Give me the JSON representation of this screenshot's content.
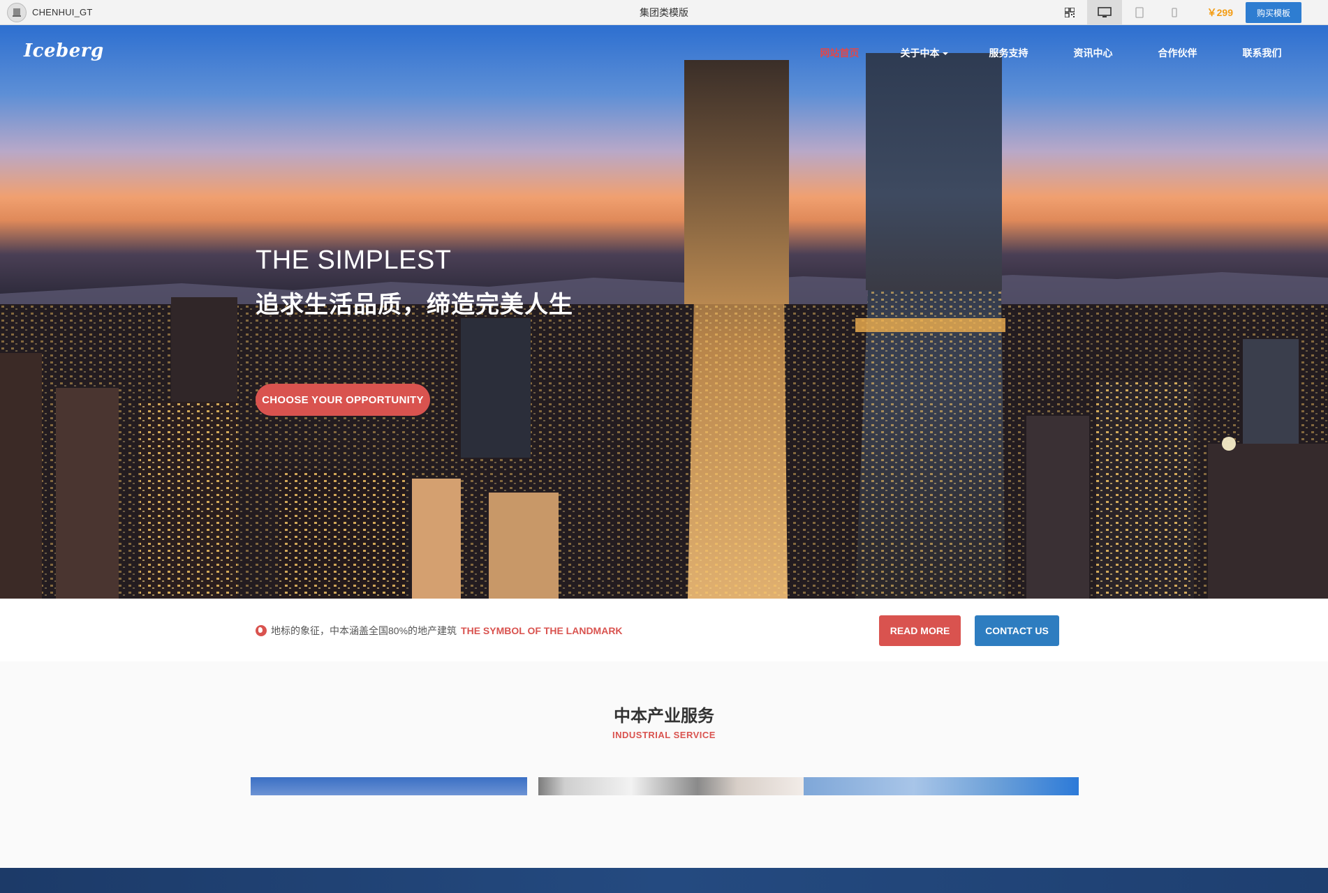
{
  "topbar": {
    "brand_name": "CHENHUI_GT",
    "page_title": "集团类模版",
    "price": "￥299",
    "buy_label": "购买模板",
    "icons": [
      "qrcode-icon",
      "desktop-icon",
      "tablet-icon",
      "mobile-icon"
    ]
  },
  "nav": {
    "logo": "Iceberg",
    "items": [
      {
        "label": "网站首页",
        "active": true
      },
      {
        "label": "关于中本",
        "dropdown": true
      },
      {
        "label": "服务支持"
      },
      {
        "label": "资讯中心"
      },
      {
        "label": "合作伙伴"
      },
      {
        "label": "联系我们"
      }
    ]
  },
  "hero": {
    "headline": "THE SIMPLEST",
    "subheadline": "追求生活品质，缔造完美人生",
    "cta": "CHOOSE YOUR OPPORTUNITY"
  },
  "strip": {
    "message": "地标的象征，中本涵盖全国80%的地产建筑",
    "message_en": "THE SYMBOL OF THE LANDMARK",
    "read_more": "READ MORE",
    "contact_us": "CONTACT US"
  },
  "service": {
    "title": "中本产业服务",
    "subtitle": "INDUSTRIAL SERVICE"
  },
  "colors": {
    "accent_red": "#d9534f",
    "accent_blue": "#2e7dc0",
    "price_orange": "#f39c12"
  }
}
